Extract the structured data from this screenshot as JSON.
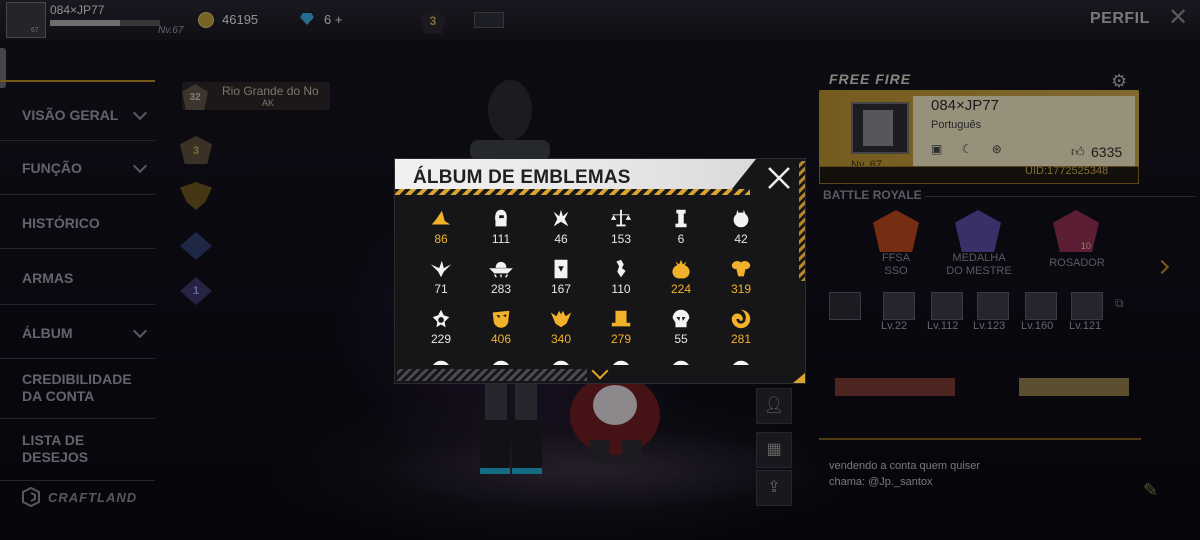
{
  "topbar": {
    "player_name": "084×JP77",
    "level": "Nv.67",
    "coins": "46195",
    "diamonds": "6 +",
    "rank_badge": "3",
    "title": "PERFIL",
    "close_glyph": "✕"
  },
  "sidebar": {
    "items": [
      {
        "label": "VISÃO GERAL",
        "has_chevron": true
      },
      {
        "label": "FUNÇÃO",
        "has_chevron": true
      },
      {
        "label": "HISTÓRICO",
        "has_chevron": false
      },
      {
        "label": "ARMAS",
        "has_chevron": false
      },
      {
        "label": "ÁLBUM",
        "has_chevron": true
      },
      {
        "label": "CREDIBILIDADE DA CONTA",
        "has_chevron": false
      },
      {
        "label": "LISTA DE DESEJOS",
        "has_chevron": false
      }
    ],
    "footer": "CRAFTLAND"
  },
  "center": {
    "guild_level": "32",
    "guild_name": "Rio Grande do No",
    "guild_abbr": "AK",
    "rank_badges": [
      "3",
      "",
      "",
      "1"
    ]
  },
  "profile": {
    "logo": "FREE FIRE",
    "name": "084×JP77",
    "language": "Português",
    "level": "Nv. 67",
    "likes": "6335",
    "uid": "UID:1772525348",
    "section": "BATTLE ROYALE",
    "badges": [
      {
        "name": "FFSA\nSSO",
        "color": "#b5481c"
      },
      {
        "name": "MEDALHA\nDO MESTRE",
        "color": "#5a4aa0"
      },
      {
        "name": "ROSADOR",
        "color": "#8e2f4e"
      }
    ],
    "badge_count": "10",
    "item_levels": [
      "Lv.22",
      "Lv.112",
      "Lv.123",
      "Lv.160",
      "Lv.121"
    ],
    "bio_line1": "vendendo a conta quem quiser",
    "bio_line2": "chama: @Jp._santox",
    "colors": {
      "gold": "#c7a04a",
      "accent": "#d9a430"
    }
  },
  "modal": {
    "title": "ÁLBUM DE EMBLEMAS",
    "emblems": [
      {
        "icon": "witch-hat-icon",
        "count": "86",
        "gold": true
      },
      {
        "icon": "knight-helmet-icon",
        "count": "111",
        "gold": false
      },
      {
        "icon": "dragon-icon",
        "count": "46",
        "gold": false
      },
      {
        "icon": "scales-icon",
        "count": "153",
        "gold": false
      },
      {
        "icon": "tower-icon",
        "count": "6",
        "gold": false
      },
      {
        "icon": "rabbit-icon",
        "count": "42",
        "gold": false
      },
      {
        "icon": "bird-icon",
        "count": "71",
        "gold": false
      },
      {
        "icon": "ufo-icon",
        "count": "283",
        "gold": false
      },
      {
        "icon": "card-icon",
        "count": "167",
        "gold": false
      },
      {
        "icon": "scorpion-icon",
        "count": "110",
        "gold": false
      },
      {
        "icon": "pineapple-icon",
        "count": "224",
        "gold": true
      },
      {
        "icon": "ram-icon",
        "count": "319",
        "gold": true
      },
      {
        "icon": "spinner-icon",
        "count": "229",
        "gold": false
      },
      {
        "icon": "mask-icon",
        "count": "406",
        "gold": true
      },
      {
        "icon": "bat-icon",
        "count": "340",
        "gold": true
      },
      {
        "icon": "top-hat-icon",
        "count": "279",
        "gold": true
      },
      {
        "icon": "skull-icon",
        "count": "55",
        "gold": false
      },
      {
        "icon": "swirl-icon",
        "count": "281",
        "gold": true
      }
    ]
  }
}
